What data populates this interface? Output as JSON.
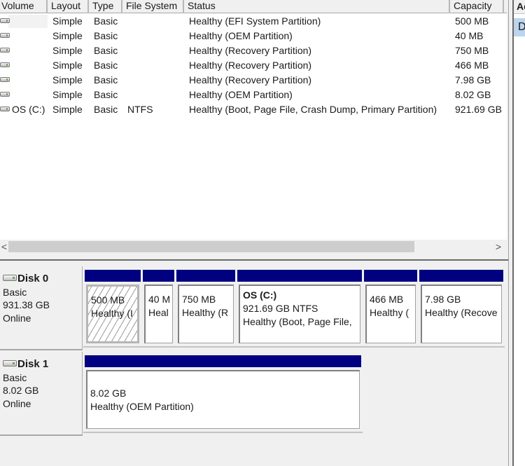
{
  "volume_list": {
    "columns": [
      "Volume",
      "Layout",
      "Type",
      "File System",
      "Status",
      "Capacity"
    ],
    "rows": [
      {
        "volume": "",
        "layout": "Simple",
        "type": "Basic",
        "fs": "",
        "status": "Healthy (EFI System Partition)",
        "capacity": "500 MB"
      },
      {
        "volume": "",
        "layout": "Simple",
        "type": "Basic",
        "fs": "",
        "status": "Healthy (OEM Partition)",
        "capacity": "40 MB"
      },
      {
        "volume": "",
        "layout": "Simple",
        "type": "Basic",
        "fs": "",
        "status": "Healthy (Recovery Partition)",
        "capacity": "750 MB"
      },
      {
        "volume": "",
        "layout": "Simple",
        "type": "Basic",
        "fs": "",
        "status": "Healthy (Recovery Partition)",
        "capacity": "466 MB"
      },
      {
        "volume": "",
        "layout": "Simple",
        "type": "Basic",
        "fs": "",
        "status": "Healthy (Recovery Partition)",
        "capacity": "7.98 GB"
      },
      {
        "volume": "",
        "layout": "Simple",
        "type": "Basic",
        "fs": "",
        "status": "Healthy (OEM Partition)",
        "capacity": "8.02 GB"
      },
      {
        "volume": "OS (C:)",
        "layout": "Simple",
        "type": "Basic",
        "fs": "NTFS",
        "status": "Healthy (Boot, Page File, Crash Dump, Primary Partition)",
        "capacity": "921.69 GB"
      }
    ],
    "icons": {
      "volume": "drive-icon"
    }
  },
  "scrollbar": {
    "left_arrow": "<",
    "right_arrow": ">"
  },
  "disks": [
    {
      "name": "Disk 0",
      "type": "Basic",
      "size": "931.38 GB",
      "state": "Online",
      "partitions": [
        {
          "title": "",
          "size": "500 MB",
          "status": "Healthy (EFI System Partition)",
          "shown_status": "Healthy (I",
          "selected": true
        },
        {
          "title": "",
          "size": "40 MB",
          "shown_size": "40 M",
          "status": "Healthy (OEM Partition)",
          "shown_status": "Heal",
          "selected": false
        },
        {
          "title": "",
          "size": "750 MB",
          "status": "Healthy (Recovery Partition)",
          "shown_status": "Healthy (R",
          "selected": false
        },
        {
          "title": "OS  (C:)",
          "size": "921.69 GB NTFS",
          "status": "Healthy (Boot, Page File, Crash Dump, Primary Partition)",
          "shown_status": "Healthy (Boot, Page File,",
          "selected": false
        },
        {
          "title": "",
          "size": "466 MB",
          "status": "Healthy (Recovery Partition)",
          "shown_status": "Healthy (",
          "selected": false
        },
        {
          "title": "",
          "size": "7.98 GB",
          "status": "Healthy (Recovery Partition)",
          "shown_status": "Healthy (Recove",
          "selected": false
        }
      ]
    },
    {
      "name": "Disk 1",
      "type": "Basic",
      "size": "8.02 GB",
      "state": "Online",
      "partitions": [
        {
          "title": "",
          "size": "8.02 GB",
          "status": "Healthy (OEM Partition)",
          "shown_status": "Healthy (OEM Partition)",
          "selected": false
        }
      ]
    }
  ],
  "actions_pane": {
    "header": "Ac",
    "selected_item": "D"
  },
  "colors": {
    "partition_bar": "#000080",
    "selection": "#bcd4ec"
  }
}
